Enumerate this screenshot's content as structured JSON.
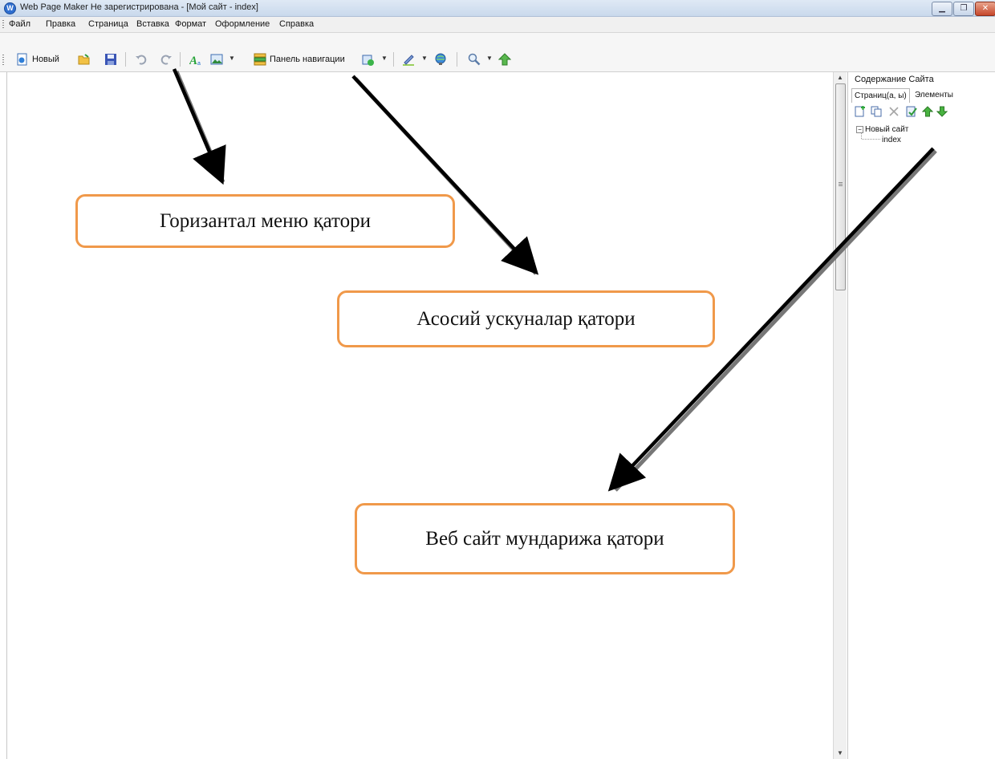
{
  "window": {
    "title": "Web Page Maker Не зарегистрирована - [Мой сайт - index]",
    "controls": [
      "minimize",
      "restore",
      "close"
    ]
  },
  "menu": {
    "items": [
      "Файл",
      "Правка",
      "Страница",
      "Вставка",
      "Формат",
      "Оформление",
      "Справка"
    ]
  },
  "toolbar": {
    "new_label": "Новый",
    "nav_panel_label": "Панель навигации",
    "icons": [
      "new-page-icon",
      "open-folder-icon",
      "save-icon",
      "undo-icon",
      "redo-icon",
      "text-icon",
      "image-icon",
      "nav-panel-icon",
      "add-element-icon",
      "edit-icon",
      "publish-icon",
      "zoom-icon",
      "upload-icon"
    ]
  },
  "panel": {
    "title": "Содержание Сайта",
    "tabs": [
      "Страниц(а, ы)",
      "Элементы"
    ],
    "toolbar_icons": [
      "add-page-icon",
      "duplicate-page-icon",
      "delete-icon",
      "page-properties-icon",
      "move-up-icon",
      "move-down-icon"
    ],
    "tree": {
      "root": "Новый сайт",
      "expander": "−",
      "children": [
        "index"
      ]
    }
  },
  "annotations": [
    "Горизантал меню қатори",
    "Асосий ускуналар қатори",
    "Веб сайт мундарижа қатори"
  ],
  "colors": {
    "callout_border": "#f0994a",
    "arrow": "#000000",
    "titlebar": "#dfe9f5"
  }
}
